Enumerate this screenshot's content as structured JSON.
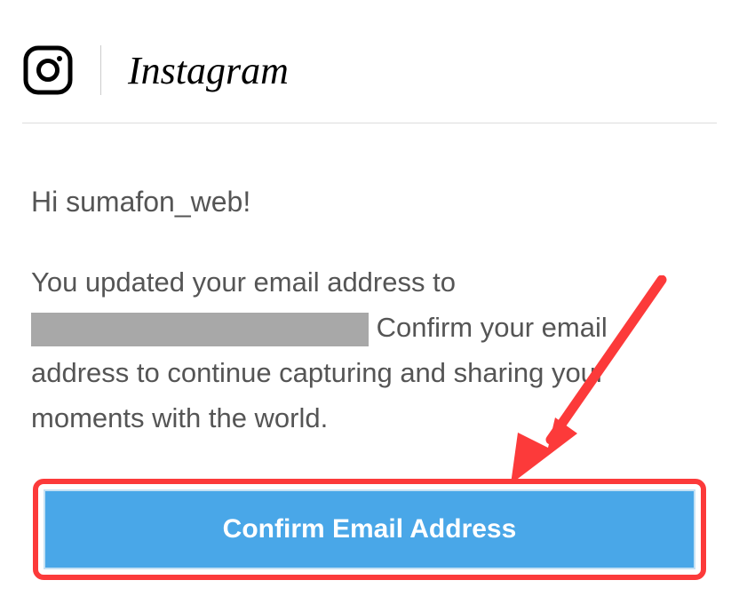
{
  "header": {
    "brand": "Instagram"
  },
  "content": {
    "greeting": "Hi sumafon_web!",
    "body_before": "You updated your email address to",
    "body_after": " Confirm your email address to continue capturing and sharing your moments with the world."
  },
  "button": {
    "confirm_label": "Confirm Email Address"
  }
}
